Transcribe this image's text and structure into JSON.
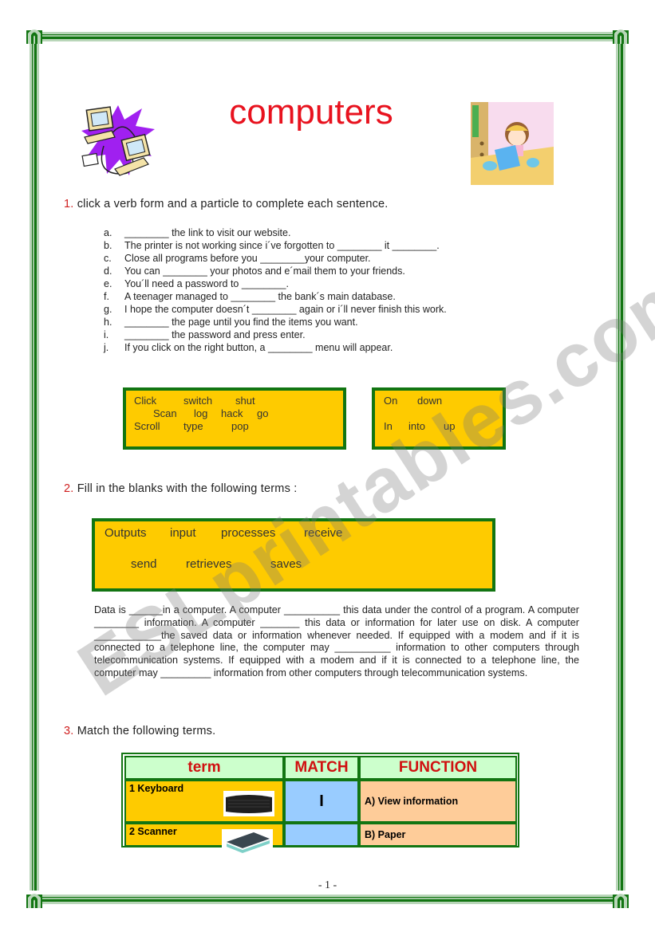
{
  "title": "computers",
  "images": {
    "left_clipart": "networked-computers-clipart",
    "right_clipart": "girl-at-laptop-clipart"
  },
  "section1": {
    "number": "1.",
    "heading": " click a verb form and a particle to complete each sentence.",
    "sentences": [
      {
        "letter": "a.",
        "text": "________ the link to visit our website."
      },
      {
        "letter": "b.",
        "text": "The printer is not working since i´ve forgotten to ________ it ________."
      },
      {
        "letter": "c.",
        "text": "Close all programs before you ________your computer."
      },
      {
        "letter": "d.",
        "text": "You can ________ your photos and e´mail them to your friends."
      },
      {
        "letter": "e.",
        "text": "You´ll need a password to ________."
      },
      {
        "letter": "f.",
        "text": "A teenager managed to ________ the bank´s main database."
      },
      {
        "letter": "g.",
        "text": "I hope the computer doesn´t ________ again or i´ll never finish this work."
      },
      {
        "letter": "h.",
        "text": "________ the page until you find the items you want."
      },
      {
        "letter": "i.",
        "text": "________ the password and press enter."
      },
      {
        "letter": "j.",
        "text": "If you click on the right button, a ________ menu will appear."
      }
    ],
    "verbs": [
      "Click",
      "switch",
      "shut",
      "Scan",
      "log",
      "hack",
      "go",
      "Scroll",
      "type",
      "pop"
    ],
    "particles": [
      "On",
      "down",
      "In",
      "into",
      "up"
    ]
  },
  "section2": {
    "number": "2.",
    "heading": " Fill in the blanks with the following terms :",
    "terms": [
      "Outputs",
      "input",
      "processes",
      "receive",
      "send",
      "retrieves",
      "saves"
    ],
    "paragraph": "Data is ______in a computer. A computer __________ this data under the control of a program. A computer ________ information. A computer _______ this data or information for later use on disk. A computer ____________the saved data or information whenever needed. If equipped with a modem and if it is connected to a telephone line, the computer may __________ information to other computers through telecommunication systems. If equipped with a modem and if it is connected to a telephone line, the computer may _________ information from other computers through telecommunication systems."
  },
  "section3": {
    "number": "3.",
    "heading": " Match the following terms.",
    "headers": [
      "term",
      "MATCH",
      "FUNCTION"
    ],
    "rows": [
      {
        "term": "1 Keyboard",
        "image": "keyboard-image",
        "match": "I",
        "function": "A) View information"
      },
      {
        "term": "2 Scanner",
        "image": "scanner-image",
        "match": "",
        "function": "B) Paper"
      }
    ]
  },
  "page_number": "- 1 -",
  "watermark": "ESLprintables.com",
  "colors": {
    "title": "#e8121e",
    "frame_green": "#127512",
    "box_yellow": "#fecb00",
    "header_green": "#ccffcc",
    "match_blue": "#99ccff",
    "function_peach": "#fecc99"
  }
}
